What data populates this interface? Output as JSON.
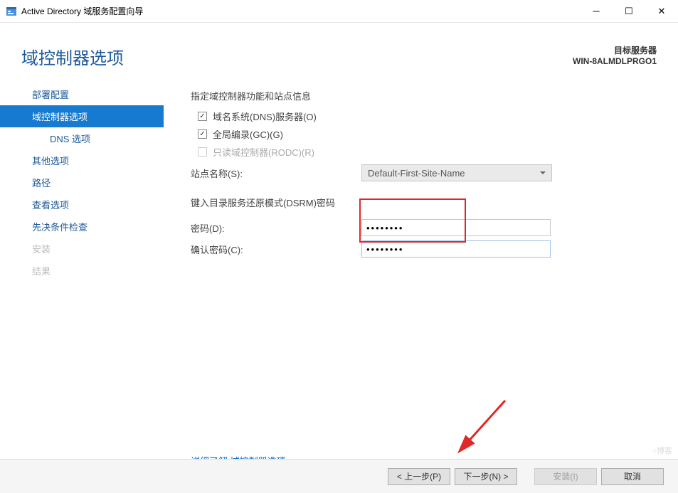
{
  "window": {
    "title": "Active Directory 域服务配置向导"
  },
  "header": {
    "page_title": "域控制器选项",
    "target_label": "目标服务器",
    "target_server": "WIN-8ALMDLPRGO1"
  },
  "sidebar": {
    "steps": [
      {
        "label": "部署配置",
        "active": false,
        "disabled": false,
        "sub": false
      },
      {
        "label": "域控制器选项",
        "active": true,
        "disabled": false,
        "sub": false
      },
      {
        "label": "DNS 选项",
        "active": false,
        "disabled": false,
        "sub": true
      },
      {
        "label": "其他选项",
        "active": false,
        "disabled": false,
        "sub": false
      },
      {
        "label": "路径",
        "active": false,
        "disabled": false,
        "sub": false
      },
      {
        "label": "查看选项",
        "active": false,
        "disabled": false,
        "sub": false
      },
      {
        "label": "先决条件检查",
        "active": false,
        "disabled": false,
        "sub": false
      },
      {
        "label": "安装",
        "active": false,
        "disabled": true,
        "sub": false
      },
      {
        "label": "结果",
        "active": false,
        "disabled": true,
        "sub": false
      }
    ]
  },
  "main": {
    "capabilities_label": "指定域控制器功能和站点信息",
    "checkboxes": [
      {
        "label": "域名系统(DNS)服务器(O)",
        "checked": true,
        "disabled": false
      },
      {
        "label": "全局编录(GC)(G)",
        "checked": true,
        "disabled": false
      },
      {
        "label": "只读域控制器(RODC)(R)",
        "checked": false,
        "disabled": true
      }
    ],
    "site_name_label": "站点名称(S):",
    "site_name_value": "Default-First-Site-Name",
    "dsrm_label": "键入目录服务还原模式(DSRM)密码",
    "password_label": "密码(D):",
    "password_value": "••••••••",
    "confirm_label": "确认密码(C):",
    "confirm_value": "••••••••",
    "learn_more_text": "详细了解",
    "learn_more_link": "域控制器选项"
  },
  "footer": {
    "prev": "< 上一步(P)",
    "next": "下一步(N) >",
    "install": "安装(I)",
    "cancel": "取消"
  },
  "watermark": "○博客"
}
